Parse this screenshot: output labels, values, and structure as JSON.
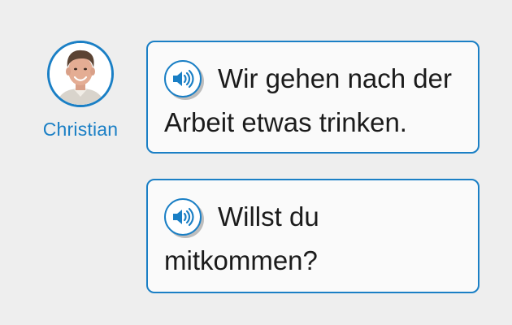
{
  "speaker": {
    "name": "Christian",
    "avatar_icon": "person-photo"
  },
  "messages": [
    {
      "text": "Wir gehen nach der Arbeit etwas trinken.",
      "audio_icon": "speaker-audio-icon"
    },
    {
      "text": "Willst du mitkommen?",
      "audio_icon": "speaker-audio-icon"
    }
  ],
  "colors": {
    "accent": "#1a7fc5",
    "background": "#eeeeee",
    "bubble_background": "#fafafa",
    "text": "#1b1b1b"
  }
}
